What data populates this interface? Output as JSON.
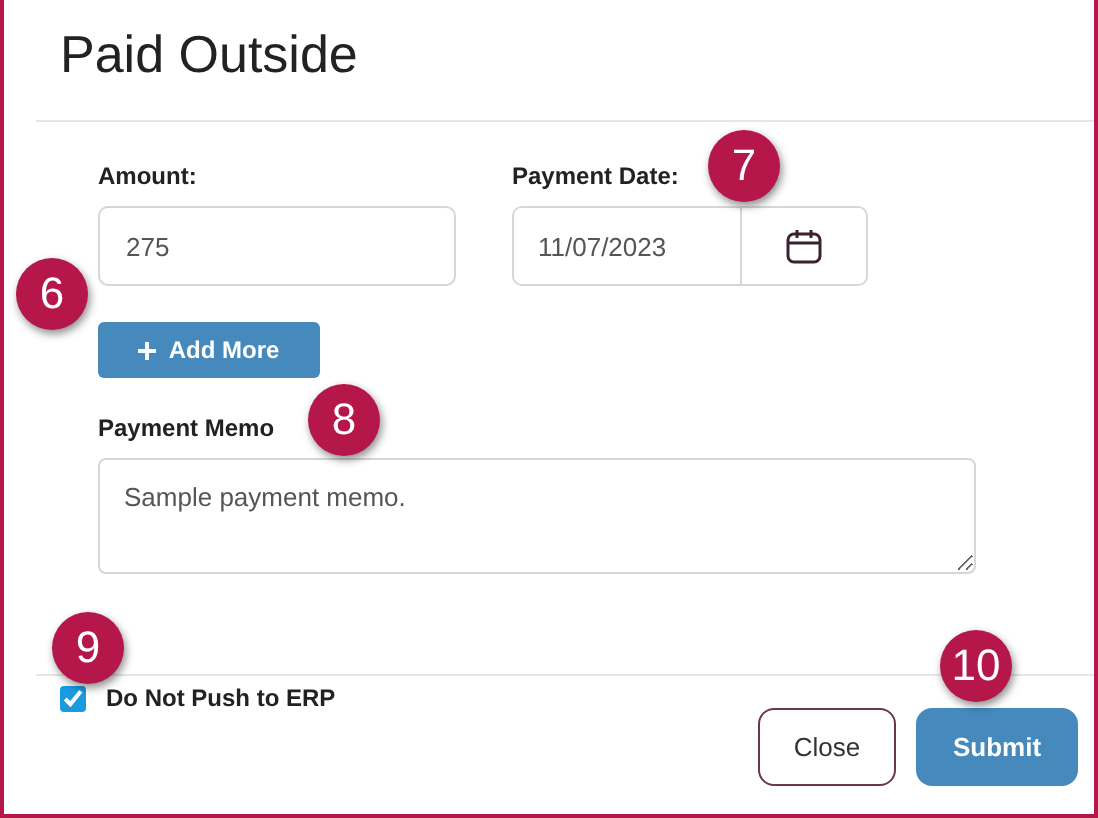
{
  "dialog": {
    "title": "Paid Outside"
  },
  "amount": {
    "label": "Amount:",
    "value": "275"
  },
  "payment_date": {
    "label": "Payment Date:",
    "value": "11/07/2023"
  },
  "add_more_button": {
    "label": "Add More"
  },
  "payment_memo": {
    "label": "Payment Memo",
    "value": "Sample payment memo."
  },
  "do_not_push": {
    "label": "Do Not Push to ERP",
    "checked": true
  },
  "buttons": [
    {
      "label": "Close",
      "kind": "secondary"
    },
    {
      "label": "Submit",
      "kind": "primary"
    }
  ],
  "callouts": [
    {
      "number": "6"
    },
    {
      "number": "7"
    },
    {
      "number": "8"
    },
    {
      "number": "9"
    },
    {
      "number": "10"
    }
  ]
}
